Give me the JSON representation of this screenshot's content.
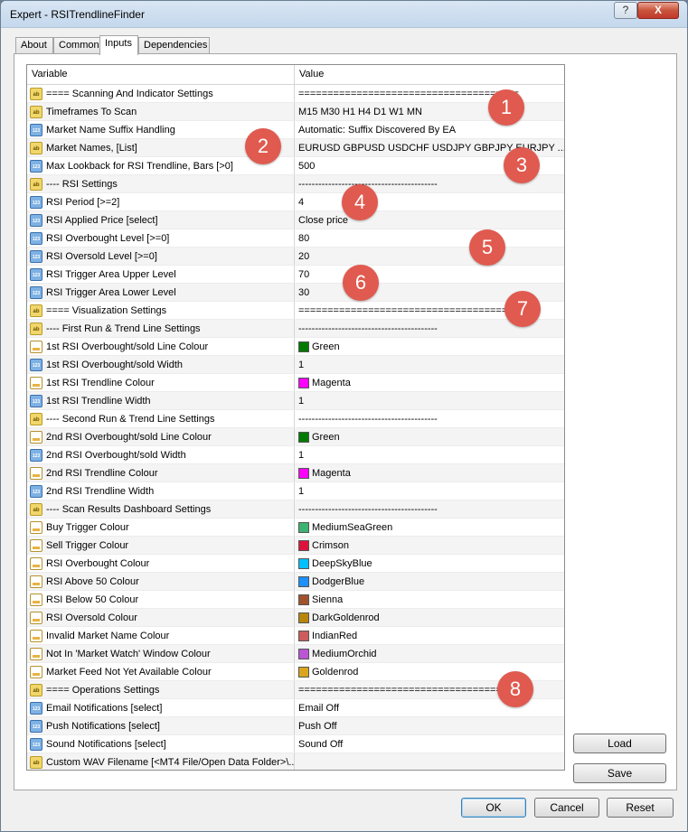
{
  "window": {
    "title": "Expert - RSITrendlineFinder",
    "help": "?",
    "close": "X"
  },
  "tabs": [
    "About",
    "Common",
    "Inputs",
    "Dependencies"
  ],
  "grid": {
    "col_variable": "Variable",
    "col_value": "Value",
    "rows": [
      {
        "icon": "ab",
        "variable": "==== Scanning And Indicator Settings",
        "value": "======================================"
      },
      {
        "icon": "ab",
        "variable": "Timeframes To Scan",
        "value": "M15 M30 H1 H4 D1 W1 MN"
      },
      {
        "icon": "num",
        "variable": "Market Name Suffix Handling",
        "value": "Automatic: Suffix Discovered By EA"
      },
      {
        "icon": "ab",
        "variable": "Market Names, [List]",
        "value": "EURUSD GBPUSD USDCHF USDJPY GBPJPY EURJPY ..."
      },
      {
        "icon": "num",
        "variable": "Max Lookback for RSI Trendline, Bars [>0]",
        "value": "500"
      },
      {
        "icon": "ab",
        "variable": "---- RSI Settings",
        "value": "------------------------------------------"
      },
      {
        "icon": "num",
        "variable": "RSI Period [>=2]",
        "value": "4"
      },
      {
        "icon": "num",
        "variable": "RSI Applied Price [select]",
        "value": "Close price"
      },
      {
        "icon": "num",
        "variable": "RSI Overbought Level [>=0]",
        "value": "80"
      },
      {
        "icon": "num",
        "variable": "RSI Oversold Level [>=0]",
        "value": "20"
      },
      {
        "icon": "num",
        "variable": "RSI Trigger Area Upper Level",
        "value": "70"
      },
      {
        "icon": "num",
        "variable": "RSI Trigger Area Lower Level",
        "value": "30"
      },
      {
        "icon": "ab",
        "variable": "==== Visualization Settings",
        "value": "======================================"
      },
      {
        "icon": "ab",
        "variable": "---- First Run & Trend Line Settings",
        "value": "------------------------------------------"
      },
      {
        "icon": "color",
        "variable": "1st RSI Overbought/sold Line Colour",
        "value": "Green",
        "swatch": "#007a00"
      },
      {
        "icon": "num",
        "variable": "1st RSI Overbought/sold Width",
        "value": "1"
      },
      {
        "icon": "color",
        "variable": "1st RSI Trendline Colour",
        "value": "Magenta",
        "swatch": "#ff00ff"
      },
      {
        "icon": "num",
        "variable": "1st RSI Trendline Width",
        "value": "1"
      },
      {
        "icon": "ab",
        "variable": "---- Second Run & Trend Line Settings",
        "value": "------------------------------------------"
      },
      {
        "icon": "color",
        "variable": "2nd RSI Overbought/sold Line Colour",
        "value": "Green",
        "swatch": "#007a00"
      },
      {
        "icon": "num",
        "variable": "2nd RSI Overbought/sold Width",
        "value": "1"
      },
      {
        "icon": "color",
        "variable": "2nd RSI Trendline Colour",
        "value": "Magenta",
        "swatch": "#ff00ff"
      },
      {
        "icon": "num",
        "variable": "2nd RSI Trendline Width",
        "value": "1"
      },
      {
        "icon": "ab",
        "variable": "---- Scan Results Dashboard Settings",
        "value": "------------------------------------------"
      },
      {
        "icon": "color",
        "variable": "Buy Trigger Colour",
        "value": "MediumSeaGreen",
        "swatch": "#3cb371"
      },
      {
        "icon": "color",
        "variable": "Sell Trigger Colour",
        "value": "Crimson",
        "swatch": "#dc143c"
      },
      {
        "icon": "color",
        "variable": "RSI Overbought Colour",
        "value": "DeepSkyBlue",
        "swatch": "#00bfff"
      },
      {
        "icon": "color",
        "variable": "RSI Above 50 Colour",
        "value": "DodgerBlue",
        "swatch": "#1e90ff"
      },
      {
        "icon": "color",
        "variable": "RSI Below 50 Colour",
        "value": "Sienna",
        "swatch": "#a0522d"
      },
      {
        "icon": "color",
        "variable": "RSI Oversold Colour",
        "value": "DarkGoldenrod",
        "swatch": "#b8860b"
      },
      {
        "icon": "color",
        "variable": "Invalid Market Name Colour",
        "value": "IndianRed",
        "swatch": "#cd5c5c"
      },
      {
        "icon": "color",
        "variable": "Not In 'Market Watch' Window Colour",
        "value": "MediumOrchid",
        "swatch": "#ba55d3"
      },
      {
        "icon": "color",
        "variable": "Market Feed Not Yet Available Colour",
        "value": "Goldenrod",
        "swatch": "#daa520"
      },
      {
        "icon": "ab",
        "variable": "==== Operations Settings",
        "value": "======================================"
      },
      {
        "icon": "num",
        "variable": "Email Notifications [select]",
        "value": "Email Off"
      },
      {
        "icon": "num",
        "variable": "Push Notifications [select]",
        "value": "Push Off"
      },
      {
        "icon": "num",
        "variable": "Sound Notifications [select]",
        "value": "Sound Off"
      },
      {
        "icon": "ab",
        "variable": "Custom WAV Filename [<MT4 File/Open Data Folder>\\...",
        "value": ""
      }
    ]
  },
  "badges": [
    "1",
    "2",
    "3",
    "4",
    "5",
    "6",
    "7",
    "8"
  ],
  "buttons": {
    "load": "Load",
    "save": "Save",
    "ok": "OK",
    "cancel": "Cancel",
    "reset": "Reset"
  },
  "colors": {
    "badge": "#e05a4f",
    "titlebar": "#c4d7ec"
  }
}
